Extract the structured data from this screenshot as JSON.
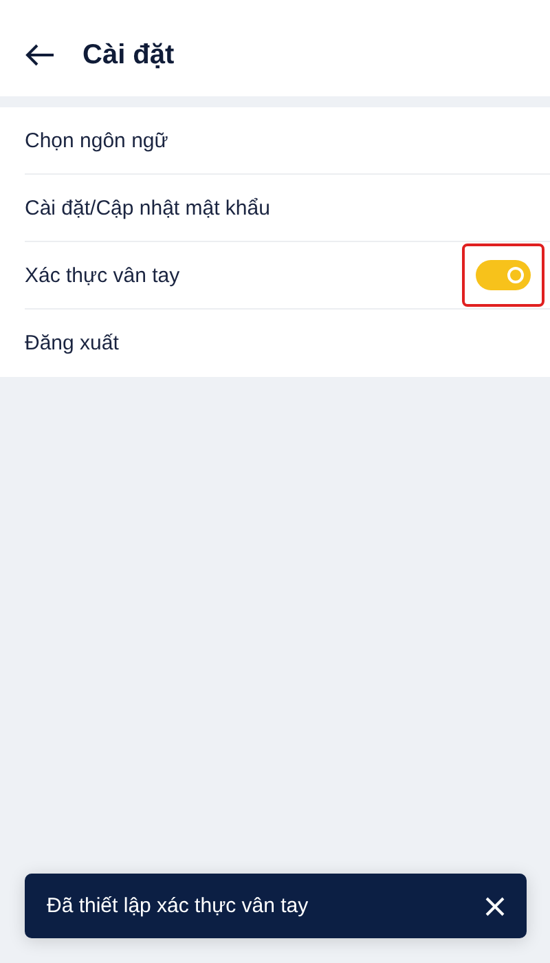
{
  "header": {
    "title": "Cài đặt"
  },
  "items": [
    {
      "kind": "link",
      "label": "Chọn ngôn ngữ"
    },
    {
      "kind": "link",
      "label": "Cài đặt/Cập nhật mật khẩu"
    },
    {
      "kind": "toggle",
      "label": "Xác thực vân tay",
      "on": true,
      "highlighted": true
    },
    {
      "kind": "link",
      "label": "Đăng xuất"
    }
  ],
  "toast": {
    "message": "Đã thiết lập xác thực vân tay"
  }
}
